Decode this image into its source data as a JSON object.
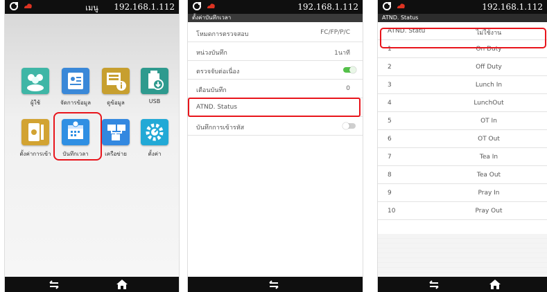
{
  "screens": [
    {
      "status": {
        "title": "เมนู",
        "ip": "192.168.1.112"
      },
      "apps": [
        {
          "label": "ผู้ใช้",
          "icon": "users-icon",
          "color": "#3fb6a6"
        },
        {
          "label": "จัดการข้อมูล",
          "icon": "id-card-icon",
          "color": "#3a88d8"
        },
        {
          "label": "ดูข้อมูล",
          "icon": "info-panel-icon",
          "color": "#c79f2f"
        },
        {
          "label": "USB",
          "icon": "usb-download-icon",
          "color": "#2e9a8e"
        },
        {
          "label": "ตั้งค่าการเข้า",
          "icon": "access-settings-icon",
          "color": "#d2a332"
        },
        {
          "label": "บันทึกเวลา",
          "icon": "calendar-clock-icon",
          "color": "#2f8fe3"
        },
        {
          "label": "เครือข่าย",
          "icon": "network-icon",
          "color": "#3388e0"
        },
        {
          "label": "ตั้งค่า",
          "icon": "settings-gear-icon",
          "color": "#22a9d6"
        }
      ]
    },
    {
      "status": {
        "ip": "192.168.1.112"
      },
      "header": "ตั้งค่าบันทึกเวลา",
      "rows": [
        {
          "label": "โหมดการตรวจสอบ",
          "value": "FC/FP/P/C"
        },
        {
          "label": "หน่วงบันทึก",
          "value": "1นาที"
        },
        {
          "label": "ตรวจจับต่อเนื่อง",
          "value": ""
        },
        {
          "label": "เตือนบันทึก",
          "value": "0"
        },
        {
          "label": "ATND. Status",
          "value": ""
        },
        {
          "label": "บันทึกการเข้ารหัส",
          "value": ""
        }
      ]
    },
    {
      "status": {
        "ip": "192.168.1.112"
      },
      "header": "ATND. Status",
      "rows": [
        {
          "n": "ATND. Statu",
          "v": "ไม่ใช้งาน"
        },
        {
          "n": "1",
          "v": "On Duty"
        },
        {
          "n": "2",
          "v": "Off Duty"
        },
        {
          "n": "3",
          "v": "Lunch In"
        },
        {
          "n": "4",
          "v": "LunchOut"
        },
        {
          "n": "5",
          "v": "OT In"
        },
        {
          "n": "6",
          "v": "OT Out"
        },
        {
          "n": "7",
          "v": "Tea In"
        },
        {
          "n": "8",
          "v": "Tea Out"
        },
        {
          "n": "9",
          "v": "Pray In"
        },
        {
          "n": "10",
          "v": "Pray Out"
        }
      ]
    }
  ],
  "colors": {
    "highlight": "#e8141b",
    "statusbar": "#0f0f0f",
    "toggle_on": "#55c14a"
  }
}
